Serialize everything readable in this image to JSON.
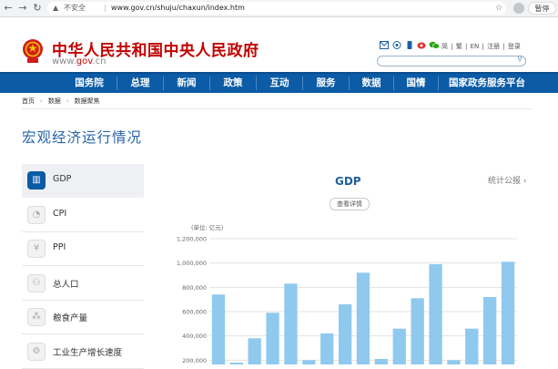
{
  "browser": {
    "insecure_label": "不安全",
    "url": "www.gov.cn/shuju/chaxun/index.htm",
    "pause_label": "暂停"
  },
  "header": {
    "site_title": "中华人民共和国中央人民政府",
    "domain_prefix": "www.",
    "domain_main": "gov",
    "domain_suffix": ".cn",
    "top_links": [
      "简",
      "繁",
      "EN",
      "注册",
      "登录"
    ]
  },
  "nav": {
    "items": [
      "国务院",
      "总理",
      "新闻",
      "政策",
      "互动",
      "服务",
      "数据",
      "国情",
      "国家政务服务平台"
    ]
  },
  "breadcrumb": {
    "items": [
      "首页",
      "数据",
      "数据聚焦"
    ]
  },
  "section_title": "宏观经济运行情况",
  "menu": {
    "items": [
      {
        "label": "GDP",
        "icon": "bar-chart-icon",
        "glyph": "▥"
      },
      {
        "label": "CPI",
        "icon": "pie-chart-icon",
        "glyph": "◔"
      },
      {
        "label": "PPI",
        "icon": "yen-icon",
        "glyph": "¥"
      },
      {
        "label": "总人口",
        "icon": "person-icon",
        "glyph": "⚇"
      },
      {
        "label": "粮食产量",
        "icon": "grain-icon",
        "glyph": "⁂"
      },
      {
        "label": "工业生产增长速度",
        "icon": "gear-icon",
        "glyph": "⚙"
      }
    ]
  },
  "chart_header": {
    "title": "GDP",
    "stats_link": "统计公报",
    "detail_button": "查看详情"
  },
  "chart_data": {
    "type": "bar",
    "ylabel": "(单位: 亿元)",
    "ylim": [
      0,
      1200000
    ],
    "yticks": [
      "1,200,000",
      "1,000,000",
      "800,000",
      "600,000",
      "400,000",
      "200,000"
    ],
    "ytick_values": [
      1200000,
      1000000,
      800000,
      600000,
      400000,
      200000
    ],
    "values": [
      740000,
      180000,
      380000,
      590000,
      830000,
      200000,
      420000,
      660000,
      920000,
      210000,
      460000,
      710000,
      990000,
      200000,
      460000,
      720000,
      1010000
    ],
    "bar_color": "#8fc9ee",
    "grid": true
  },
  "colors": {
    "nav_bg": "#0b5ba6",
    "title_red": "#c00000",
    "accent_blue": "#2765a8"
  }
}
